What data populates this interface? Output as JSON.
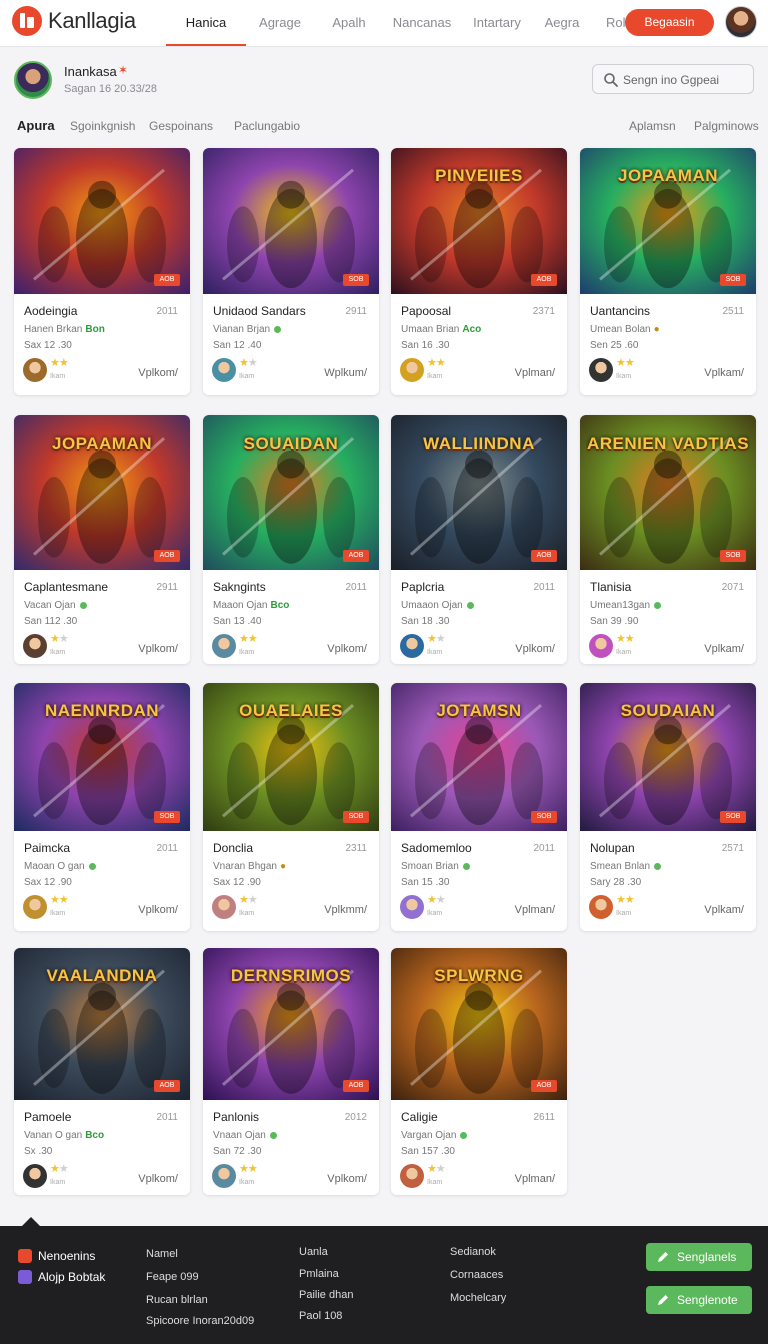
{
  "app": {
    "logo_text": "Kanllagia"
  },
  "nav": {
    "tabs": [
      "Hanica",
      "Agrage",
      "Apalh",
      "Nancanas",
      "Intartary",
      "Aegra",
      "Rolx"
    ],
    "active_tab": "Hanica",
    "cta_label": "Begaasin"
  },
  "profile": {
    "name": "Inankasa",
    "subtitle": "Sagan 16 20.33/28"
  },
  "search": {
    "placeholder": "Sengn ino Ggpeai"
  },
  "filters": {
    "left": [
      "Apura",
      "Sgoinkgnish",
      "Gespoinans",
      "Paclungabio"
    ],
    "right": [
      "Aplamsn",
      "Palgminows"
    ]
  },
  "theme": {
    "accent": "#e8492c",
    "success": "#5cb85c",
    "footer_bg": "#1f1f22"
  },
  "cards": [
    {
      "title": "Aodeingia",
      "year": "2011",
      "meta": "Hanen Brkan",
      "status": "Bon",
      "size": "Sax 12 .30",
      "rating": 2,
      "action": "Vplkom/",
      "tag": "AOB",
      "image_text": ""
    },
    {
      "title": "Unidaod Sandars",
      "year": "2911",
      "meta": "Vianan Brjan",
      "status": "",
      "size": "San 12 .40",
      "rating": 1,
      "action": "Wplkum/",
      "tag": "SOB",
      "image_text": ""
    },
    {
      "title": "Papoosal",
      "year": "2371",
      "meta": "Umaan Brian",
      "status": "Aco",
      "size": "San 16 .30",
      "rating": 2,
      "action": "Vplman/",
      "tag": "AOB",
      "image_text": "PINVEIIES"
    },
    {
      "title": "Uantancins",
      "year": "2511",
      "meta": "Umean Bolan",
      "status": "coin",
      "size": "Sen 25 .60",
      "rating": 2,
      "action": "Vplkam/",
      "tag": "SOB",
      "image_text": "JOPAAMAN"
    },
    {
      "title": "Caplantesmane",
      "year": "2911",
      "meta": "Vacan Ojan",
      "status": "",
      "size": "San 112 .30",
      "rating": 1,
      "action": "Vplkom/",
      "tag": "AOB",
      "image_text": "JOPAAMAN"
    },
    {
      "title": "Sakngints",
      "year": "2011",
      "meta": "Maaon Ojan",
      "status": "Bco",
      "size": "San 13 .40",
      "rating": 2,
      "action": "Vplkom/",
      "tag": "AOB",
      "image_text": "SOUAIDAN"
    },
    {
      "title": "Paplcria",
      "year": "2011",
      "meta": "Umaaon Ojan",
      "status": "",
      "size": "San 18 .30",
      "rating": 1,
      "action": "Vplkom/",
      "tag": "AOB",
      "image_text": "WALLIINDNA"
    },
    {
      "title": "Tlanisia",
      "year": "2071",
      "meta": "Umean13gan",
      "status": "",
      "size": "San 39 .90",
      "rating": 2,
      "action": "Vplkam/",
      "tag": "SOB",
      "image_text": "ARENIEN VADTIAS"
    },
    {
      "title": "Paimcka",
      "year": "2011",
      "meta": "Maoan O gan",
      "status": "",
      "size": "Sax 12 .90",
      "rating": 2,
      "action": "Vplkom/",
      "tag": "SOB",
      "image_text": "NAENNRDAN"
    },
    {
      "title": "Donclia",
      "year": "2311",
      "meta": "Vnaran Bhgan",
      "status": "coin",
      "size": "Sax 12 .90",
      "rating": 1,
      "action": "Vplkmm/",
      "tag": "SOB",
      "image_text": "OUAELAIES"
    },
    {
      "title": "Sadomemloo",
      "year": "2011",
      "meta": "Smoan Brian",
      "status": "",
      "size": "San 15 .30",
      "rating": 1,
      "action": "Vplman/",
      "tag": "SOB",
      "image_text": "JOTAMSN"
    },
    {
      "title": "Nolupan",
      "year": "2571",
      "meta": "Smean Bnlan",
      "status": "",
      "size": "Sary 28 .30",
      "rating": 2,
      "action": "Vplkam/",
      "tag": "SOB",
      "image_text": "SOUDAIAN"
    },
    {
      "title": "Pamoele",
      "year": "2011",
      "meta": "Vanan O gan",
      "status": "Bco",
      "size": "Sx .30",
      "rating": 1,
      "action": "Vplkom/",
      "tag": "AOB",
      "image_text": "VAALANDNA"
    },
    {
      "title": "Panlonis",
      "year": "2012",
      "meta": "Vnaan Ojan",
      "status": "",
      "size": "San 72 .30",
      "rating": 2,
      "action": "Vplkom/",
      "tag": "AOB",
      "image_text": "DERNSRIMOS"
    },
    {
      "title": "Caligie",
      "year": "2611",
      "meta": "Vargan Ojan",
      "status": "",
      "size": "San 157 .30",
      "rating": 1,
      "action": "Vplman/",
      "tag": "AOB",
      "image_text": "SPLWRNG"
    }
  ],
  "footer": {
    "brand_1": "Nenoenins",
    "brand_2": "Alojp Bobtak",
    "col_1": [
      "Namel",
      "Feape 099",
      "Rucan blrlan",
      "Spicoore Inoran20d09"
    ],
    "col_2": [
      "Uanla",
      "Pmlaina",
      "Pailie dhan",
      "Paol 108"
    ],
    "col_3": [
      "Sedianok",
      "Cornaaces",
      "Mochelcary"
    ],
    "button_1": "Senglanels",
    "button_2": "Senglenote"
  }
}
